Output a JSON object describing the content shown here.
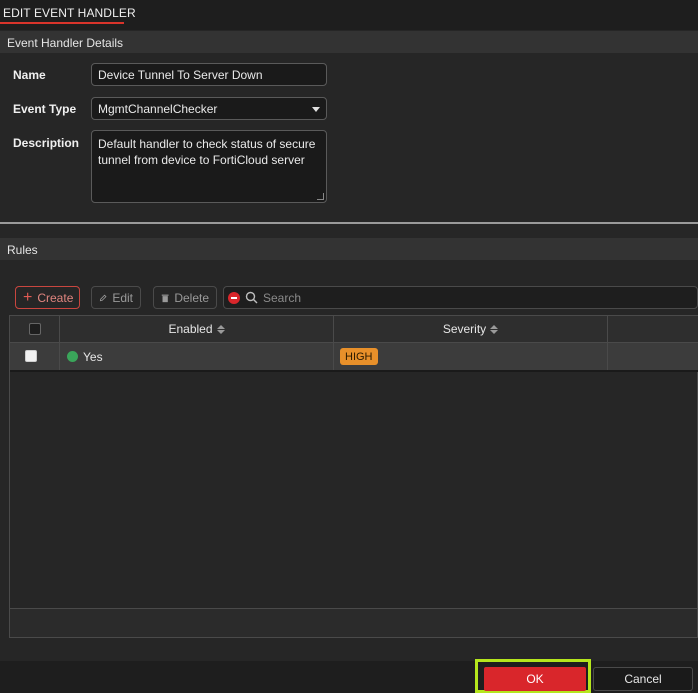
{
  "header": {
    "title": "EDIT EVENT HANDLER"
  },
  "details": {
    "section_title": "Event Handler Details",
    "name_label": "Name",
    "name_value": "Device Tunnel To Server Down",
    "event_type_label": "Event Type",
    "event_type_value": "MgmtChannelChecker",
    "description_label": "Description",
    "description_value": "Default handler to check status of secure\ntunnel from device to FortiCloud server"
  },
  "rules": {
    "section_title": "Rules",
    "toolbar": {
      "create_label": "Create",
      "edit_label": "Edit",
      "delete_label": "Delete",
      "search_placeholder": "Search"
    },
    "columns": [
      "Enabled",
      "Severity"
    ],
    "rows": [
      {
        "enabled": "Yes",
        "severity": "HIGH"
      }
    ]
  },
  "footer": {
    "ok_label": "OK",
    "cancel_label": "Cancel"
  },
  "colors": {
    "accent": "#d9262b",
    "highlight": "#b5e61d",
    "severity_high": "#e8902a",
    "enabled_green": "#3aa55a"
  }
}
